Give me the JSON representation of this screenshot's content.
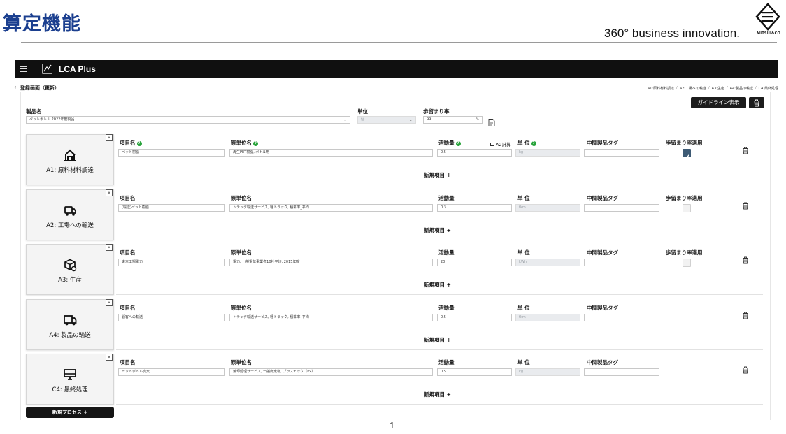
{
  "slide": {
    "title": "算定機能",
    "tagline": "360° business innovation.",
    "logo_text": "MITSUI&CO.",
    "page_number": "1"
  },
  "app": {
    "name": "LCA Plus"
  },
  "page": {
    "heading": "登録画面（更新）",
    "back_icon": "chevron-left-icon",
    "breadcrumb": [
      "A1:原料材料調達",
      "A2:工場への輸送",
      "A3:生産",
      "A4:製品の輸送",
      "C4:最終処理"
    ]
  },
  "product": {
    "name_label": "製品名",
    "name_value": "ペットボトル 2022年度製品",
    "unit_label": "単位",
    "unit_value": "個",
    "yield_label": "歩留まり率",
    "yield_value": "99",
    "yield_suffix": "%",
    "guideline_button": "ガイドライン表示"
  },
  "columns": {
    "item_name": "項目名",
    "basic_unit_name": "原単位名",
    "activity": "活動量",
    "unit": "単 位",
    "intermediate_tag": "中間製品タグ",
    "yield_apply": "歩留まり率適用",
    "a2_calc": "A2計算"
  },
  "processes": [
    {
      "code": "A1: 原料材料調達",
      "icon": "warehouse-icon",
      "item_name": "ペット樹脂",
      "basic_unit": "再生PET樹脂, ボトル用",
      "activity": "0.5",
      "unit": "kg",
      "tag": "",
      "yield_apply": true,
      "has_yield": true
    },
    {
      "code": "A2: 工場への輸送",
      "icon": "truck-icon",
      "item_name": "(輸送)ペット樹脂",
      "basic_unit": "トラック輸送サービス, 軽トラック, 積載率_平均",
      "activity": "0.3",
      "unit": "tkm",
      "tag": "",
      "yield_apply": false,
      "has_yield": true
    },
    {
      "code": "A3: 生産",
      "icon": "box-gear-icon",
      "item_name": "東京工場電力",
      "basic_unit": "電力, 一般電気事業者10社平均, 2015年度",
      "activity": "20",
      "unit": "kWh",
      "tag": "",
      "yield_apply": false,
      "has_yield": true
    },
    {
      "code": "A4: 製品の輸送",
      "icon": "delivery-truck-icon",
      "item_name": "顧客への輸送",
      "basic_unit": "トラック輸送サービス, 軽トラック, 積載率_平均",
      "activity": "0.5",
      "unit": "tkm",
      "tag": "",
      "yield_apply": false,
      "has_yield": false
    },
    {
      "code": "C4: 最終処理",
      "icon": "monitor-icon",
      "item_name": "ペットボトル廃棄",
      "basic_unit": "焼却処理サービス, 一般廃棄物, プラスチック（PS）",
      "activity": "0.5",
      "unit": "kg",
      "tag": "",
      "yield_apply": false,
      "has_yield": false
    }
  ],
  "new_item_label": "新規項目 +",
  "new_process_label": "新規プロセス +",
  "colors": {
    "title_blue": "#1b3f8f",
    "check_on": "#3d5a74",
    "help_green": "#27a33a",
    "appbar": "#101010"
  }
}
